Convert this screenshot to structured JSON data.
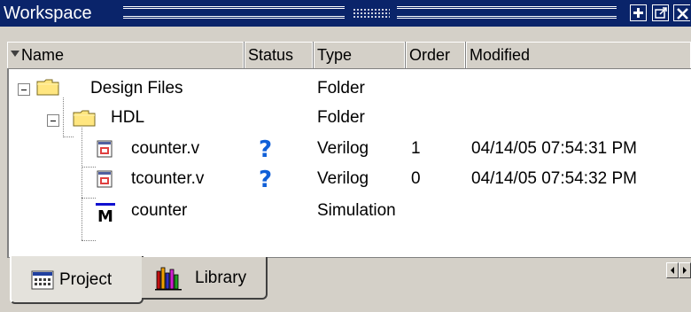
{
  "window": {
    "title": "Workspace"
  },
  "columns": [
    {
      "label": "Name"
    },
    {
      "label": "Status"
    },
    {
      "label": "Type"
    },
    {
      "label": "Order"
    },
    {
      "label": "Modified"
    }
  ],
  "tree": {
    "rows": [
      {
        "name": "Design Files",
        "type": "Folder",
        "order": "",
        "modified": "",
        "icon": "folder-icon"
      },
      {
        "name": "HDL",
        "type": "Folder",
        "order": "",
        "modified": "",
        "icon": "folder-icon"
      },
      {
        "name": "counter.v",
        "status": "?",
        "type": "Verilog",
        "order": "1",
        "modified": "04/14/05 07:54:31 PM",
        "icon": "verilog-file-icon"
      },
      {
        "name": "tcounter.v",
        "status": "?",
        "type": "Verilog",
        "order": "0",
        "modified": "04/14/05 07:54:32 PM",
        "icon": "verilog-file-icon"
      },
      {
        "name": "counter",
        "type": "Simulation",
        "order": "",
        "modified": "",
        "icon": "simulation-icon"
      }
    ]
  },
  "tabs": [
    {
      "label": "Project",
      "icon": "project-icon",
      "selected": true
    },
    {
      "label": "Library",
      "icon": "library-icon",
      "selected": false
    }
  ],
  "colors": {
    "titlebar": "#0a246a",
    "status_question": "#1060d8",
    "panel": "#d4d0c8"
  }
}
